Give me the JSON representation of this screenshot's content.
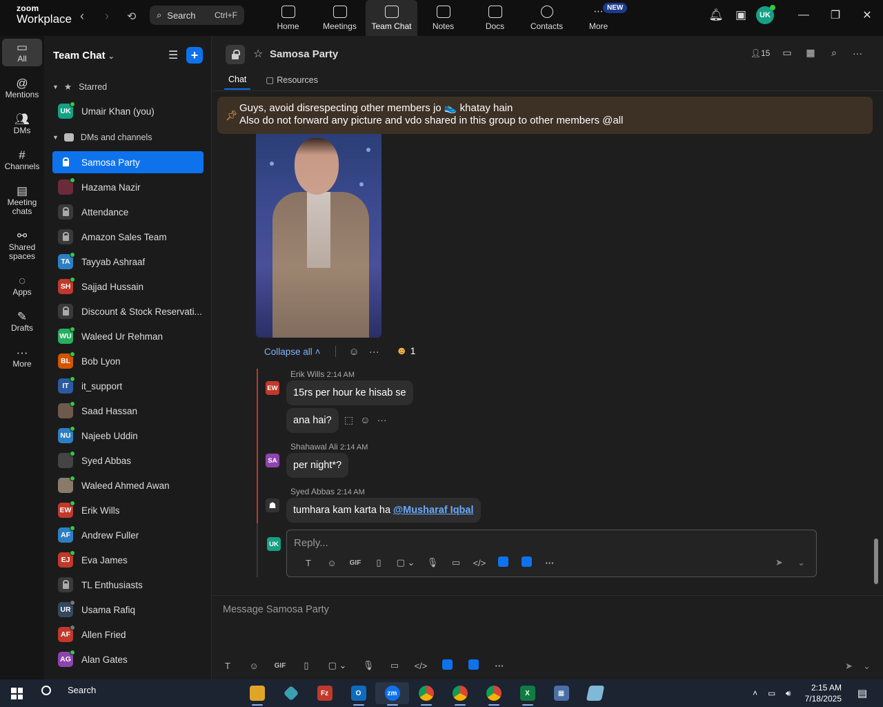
{
  "app": {
    "logo_line1": "zoom",
    "logo_line2": "Workplace",
    "search_label": "Search",
    "search_shortcut": "Ctrl+F",
    "top_nav": [
      {
        "label": "Home",
        "icon": "home-icon"
      },
      {
        "label": "Meetings",
        "icon": "video-icon"
      },
      {
        "label": "Team Chat",
        "icon": "chat-icon"
      },
      {
        "label": "Notes",
        "icon": "notes-icon"
      },
      {
        "label": "Docs",
        "icon": "docs-icon"
      },
      {
        "label": "Contacts",
        "icon": "contacts-icon"
      },
      {
        "label": "More",
        "icon": "more-icon"
      }
    ],
    "new_badge": "NEW",
    "user_initials": "UK"
  },
  "rail": [
    {
      "label": "All",
      "icon": "chat-icon"
    },
    {
      "label": "Mentions",
      "icon": "at-icon"
    },
    {
      "label": "DMs",
      "icon": "people-icon"
    },
    {
      "label": "Channels",
      "icon": "hash-icon"
    },
    {
      "label": "Meeting chats",
      "icon": "calendar-icon"
    },
    {
      "label": "Shared spaces",
      "icon": "share-icon"
    },
    {
      "label": "Apps",
      "icon": "apps-icon"
    },
    {
      "label": "Drafts",
      "icon": "edit-icon"
    },
    {
      "label": "More",
      "icon": "ellipsis-icon"
    }
  ],
  "sidebar": {
    "title": "Team Chat",
    "starred_label": "Starred",
    "starred": [
      {
        "name": "Umair Khan (you)",
        "initials": "UK",
        "color": "#16a085"
      }
    ],
    "dms_label": "DMs and channels",
    "items": [
      {
        "name": "Samosa Party",
        "initials": "",
        "color": "",
        "type": "channel",
        "active": true
      },
      {
        "name": "Hazama Nazir",
        "initials": "",
        "color": "#6b2b3a",
        "type": "photo"
      },
      {
        "name": "Attendance",
        "initials": "",
        "color": "",
        "type": "channel"
      },
      {
        "name": "Amazon Sales Team",
        "initials": "",
        "color": "",
        "type": "channel"
      },
      {
        "name": "Tayyab Ashraaf",
        "initials": "TA",
        "color": "#2d7fc4",
        "type": "user"
      },
      {
        "name": "Sajjad Hussain",
        "initials": "SH",
        "color": "#c0392b",
        "type": "user"
      },
      {
        "name": "Discount & Stock Reservati...",
        "initials": "",
        "color": "",
        "type": "channel"
      },
      {
        "name": "Waleed Ur Rehman",
        "initials": "WU",
        "color": "#27ae60",
        "type": "user"
      },
      {
        "name": "Bob Lyon",
        "initials": "BL",
        "color": "#d35400",
        "type": "user"
      },
      {
        "name": "it_support",
        "initials": "IT",
        "color": "#2c5aa0",
        "type": "user"
      },
      {
        "name": "Saad Hassan",
        "initials": "",
        "color": "#6d5a4c",
        "type": "photo"
      },
      {
        "name": "Najeeb Uddin",
        "initials": "NU",
        "color": "#2d7fc4",
        "type": "user"
      },
      {
        "name": "Syed Abbas",
        "initials": "",
        "color": "#444444",
        "type": "photo"
      },
      {
        "name": "Waleed Ahmed Awan",
        "initials": "",
        "color": "#8a7a6a",
        "type": "photo"
      },
      {
        "name": "Erik Wills",
        "initials": "EW",
        "color": "#c0392b",
        "type": "user"
      },
      {
        "name": "Andrew Fuller",
        "initials": "AF",
        "color": "#2d7fc4",
        "type": "user"
      },
      {
        "name": "Eva James",
        "initials": "EJ",
        "color": "#c0392b",
        "type": "user"
      },
      {
        "name": "TL Enthusiasts",
        "initials": "",
        "color": "",
        "type": "channel"
      },
      {
        "name": "Usama Rafiq",
        "initials": "UR",
        "color": "#34495e",
        "type": "user",
        "offline": true
      },
      {
        "name": "Allen Fried",
        "initials": "AF",
        "color": "#c0392b",
        "type": "user",
        "offline": true
      },
      {
        "name": "Alan Gates",
        "initials": "AG",
        "color": "#8e44ad",
        "type": "user"
      }
    ]
  },
  "channel": {
    "title": "Samosa Party",
    "member_count": "15",
    "tabs": [
      "Chat",
      "Resources"
    ],
    "pinned_line1": "Guys, avoid disrespecting other members jo 👟 khatay hain",
    "pinned_line2": "Also do not forward any picture and vdo shared in this group to other members @all",
    "collapse_label": "Collapse all",
    "reaction_count": "1"
  },
  "messages": [
    {
      "author": "Erik Wills",
      "time": "2:14 AM",
      "initials": "EW",
      "color": "#c0392b",
      "texts": [
        "15rs per hour ke hisab se",
        "ana hai?"
      ]
    },
    {
      "author": "Shahawal Ali",
      "time": "2:14 AM",
      "initials": "SA",
      "color": "#8e44ad",
      "texts": [
        "per night*?"
      ]
    },
    {
      "author": "Syed Abbas",
      "time": "2:14 AM",
      "initials": "",
      "color": "#333333",
      "texts": [
        "tumhara kam karta ha"
      ],
      "mention": "@Musharaf Iqbal"
    }
  ],
  "reply": {
    "placeholder": "Reply...",
    "initials": "UK"
  },
  "compose": {
    "placeholder": "Message Samosa Party"
  },
  "toolbar_gif": "GIF",
  "taskbar": {
    "search_label": "Search",
    "time": "2:15 AM",
    "date": "7/18/2025"
  }
}
